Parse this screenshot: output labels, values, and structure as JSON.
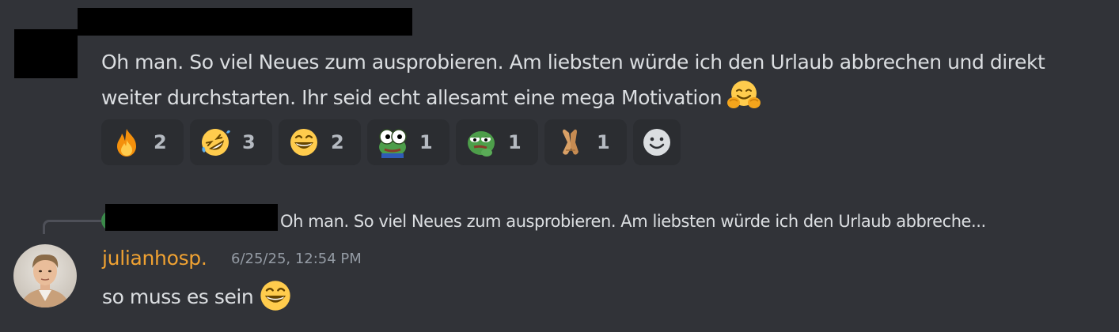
{
  "message1": {
    "text": "Oh man. So viel Neues zum ausprobieren. Am liebsten würde ich den Urlaub abbrechen und direkt weiter durchstarten. Ihr seid echt allesamt eine mega Motivation",
    "inline_emoji": "hugging-face-emoji"
  },
  "reactions": [
    {
      "emoji": "fire-emoji",
      "count": "2"
    },
    {
      "emoji": "rolling-on-floor-laughing-emoji",
      "count": "3"
    },
    {
      "emoji": "grinning-squinting-face-emoji",
      "count": "2"
    },
    {
      "emoji": "pepe-wide-eyes-emoji",
      "count": "1"
    },
    {
      "emoji": "pepe-thinking-emoji",
      "count": "1"
    },
    {
      "emoji": "folded-hands-emoji",
      "count": "1"
    }
  ],
  "add_reaction_icon": "add-reaction-smiley-icon",
  "reply": {
    "preview": "Oh man. So viel Neues zum ausprobieren. Am liebsten würde ich den Urlaub abbreche..."
  },
  "message2": {
    "username": "julianhosp.",
    "timestamp": "6/25/25, 12:54 PM",
    "text": "so muss es sein",
    "inline_emoji": "grinning-squinting-face-emoji"
  },
  "colors": {
    "background": "#313338",
    "reaction_bg": "#2b2d31",
    "username": "#f0a232",
    "text": "#dbdee1",
    "muted": "#949ba4"
  }
}
